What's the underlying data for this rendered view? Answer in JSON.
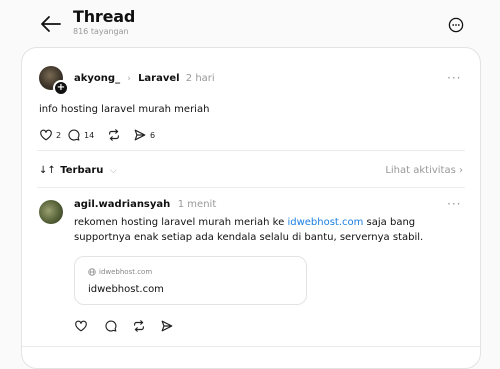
{
  "header": {
    "title": "Thread",
    "views": "816 tayangan"
  },
  "post": {
    "username": "akyong_",
    "community": "Laravel",
    "time": "2 hari",
    "text": "info hosting laravel murah meriah",
    "likes": "2",
    "comments": "14",
    "shares": "6"
  },
  "sort": {
    "arrows": "↓↑",
    "label": "Terbaru",
    "activity": "Lihat aktivitas"
  },
  "reply": {
    "username": "agil.wadriansyah",
    "time": "1 menit",
    "text_before": "rekomen hosting laravel murah meriah ke ",
    "link": "idwebhost.com",
    "text_after": " saja bang supportnya enak setiap ada kendala selalu di bantu, servernya stabil.",
    "card": {
      "domain": "idwebhost.com",
      "title": "idwebhost.com"
    }
  },
  "colors": {
    "link": "#1b7fe0",
    "muted": "#999999",
    "background": "#fafafa"
  },
  "icons": [
    "back-arrow-icon",
    "more-circle-icon",
    "heart-icon",
    "comment-icon",
    "repost-icon",
    "send-icon",
    "globe-icon",
    "more-dots-icon",
    "chevron-right-icon",
    "chevron-down-icon"
  ]
}
